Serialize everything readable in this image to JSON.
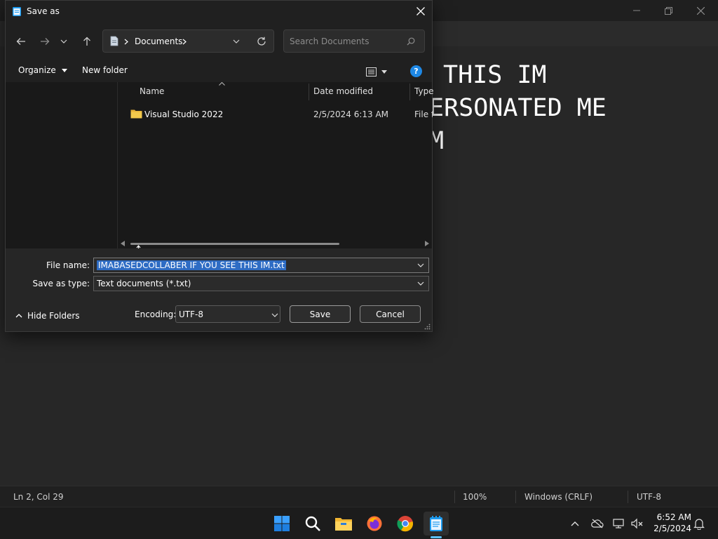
{
  "editor": {
    "lines": [
      "THIS IM",
      "ERSONATED ME",
      "M"
    ]
  },
  "status_bar": {
    "position": "Ln 2, Col 29",
    "zoom": "100%",
    "line_ending": "Windows (CRLF)",
    "encoding": "UTF-8"
  },
  "dialog": {
    "title": "Save as",
    "address": {
      "location": "Documents"
    },
    "search": {
      "placeholder": "Search Documents"
    },
    "toolbar": {
      "organize_label": "Organize",
      "new_folder_label": "New folder"
    },
    "columns": {
      "name": "Name",
      "date_modified": "Date modified",
      "type": "Type"
    },
    "files": [
      {
        "name": "Visual Studio 2022",
        "date_modified": "2/5/2024 6:13 AM",
        "type": "File fo"
      }
    ],
    "file_name": {
      "label": "File name:",
      "value": "IMABASEDCOLLABER IF YOU SEE THIS IM.txt"
    },
    "save_as_type": {
      "label": "Save as type:",
      "value": "Text documents (*.txt)"
    },
    "hide_folders_label": "Hide Folders",
    "encoding": {
      "label": "Encoding:",
      "value": "UTF-8"
    },
    "save_label": "Save",
    "cancel_label": "Cancel"
  },
  "taskbar": {
    "clock_time": "6:52 AM",
    "clock_date": "2/5/2024",
    "pinned": [
      "start-icon",
      "search-icon",
      "file-explorer-icon",
      "firefox-icon",
      "chrome-icon",
      "notepad-icon"
    ]
  },
  "colors": {
    "accent": "#2e6cc4",
    "taskbar_indicator": "#5cc1ff",
    "help": "#1e88e5",
    "folder": "#f2c94c"
  }
}
